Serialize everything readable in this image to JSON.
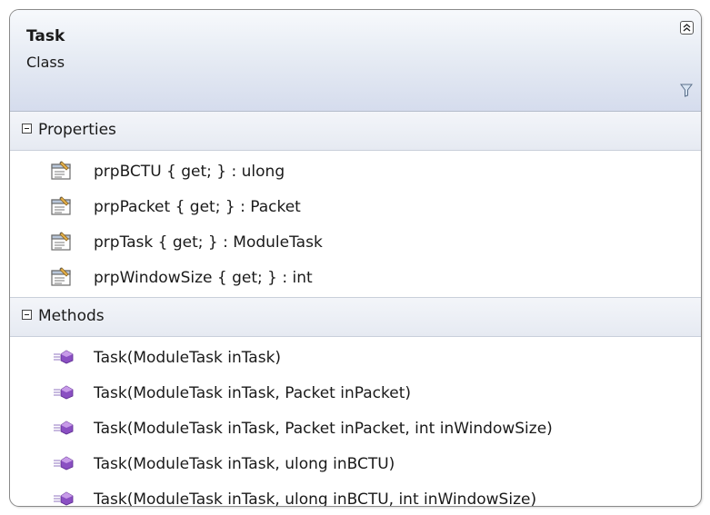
{
  "class": {
    "name": "Task",
    "kind": "Class"
  },
  "icons": {
    "collapse": "double-chevron-up-icon",
    "filter": "filter-icon",
    "property": "property-icon",
    "method": "method-icon"
  },
  "properties": {
    "label": "Properties",
    "items": [
      "prpBCTU { get; } : ulong",
      "prpPacket { get; } : Packet",
      "prpTask { get; } : ModuleTask",
      "prpWindowSize { get; } : int"
    ]
  },
  "methods": {
    "label": "Methods",
    "items": [
      "Task(ModuleTask inTask)",
      "Task(ModuleTask inTask, Packet inPacket)",
      "Task(ModuleTask inTask, Packet inPacket, int inWindowSize)",
      "Task(ModuleTask inTask, ulong inBCTU)",
      "Task(ModuleTask inTask, ulong inBCTU, int inWindowSize)"
    ]
  }
}
